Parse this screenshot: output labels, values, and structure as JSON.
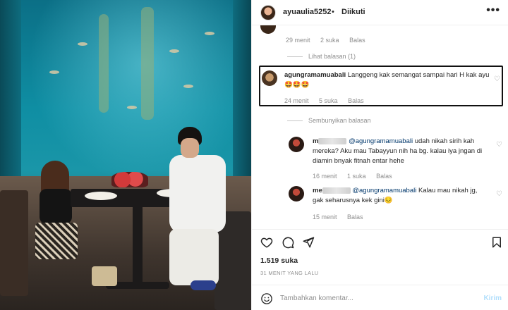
{
  "post": {
    "username": "ayuaulia5252",
    "dot": "•",
    "follow_status": "Diikuti",
    "more": "•••"
  },
  "top_comment": {
    "time": "29 menit",
    "likes": "2 suka",
    "reply": "Balas"
  },
  "view_replies": "Lihat balasan (1)",
  "highlighted_comment": {
    "username": "agungramamuabali",
    "text": "Langgeng kak semangat sampai hari H kak ayu🤩🤩🤩",
    "time": "24 menit",
    "likes": "5 suka",
    "reply": "Balas"
  },
  "hide_replies": "Sembunyikan balasan",
  "replies": [
    {
      "username_prefix": "m",
      "mention": "@agungramamuabali",
      "text": "udah nikah sirih kah mereka? Aku mau Tabayyun nih ha bg. kalau iya jngan di diamin bnyak fitnah entar hehe",
      "time": "16 menit",
      "likes": "1 suka",
      "reply": "Balas"
    },
    {
      "username_prefix": "me",
      "mention": "@agungramamuabali",
      "text": "Kalau mau nikah jg, gak seharusnya kek gini😔",
      "time": "15 menit",
      "reply": "Balas"
    }
  ],
  "likes_count": "1.519 suka",
  "posted_ago": "31 MENIT YANG LALU",
  "comment_box": {
    "placeholder": "Tambahkan komentar...",
    "send_label": "Kirim"
  },
  "icons": {
    "like": "heart-icon",
    "comment": "comment-icon",
    "share": "send-icon",
    "save": "bookmark-icon",
    "emoji": "emoji-icon"
  },
  "colors": {
    "mention": "#00376b",
    "muted": "#8e8e8e",
    "send_disabled": "#b2dffc"
  }
}
